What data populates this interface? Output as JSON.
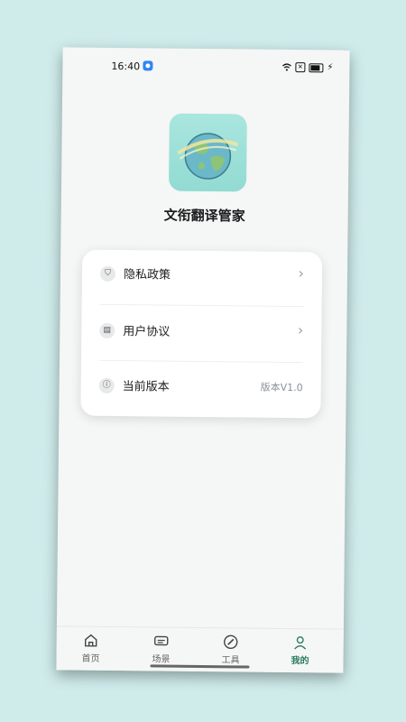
{
  "status_bar": {
    "time": "16:40"
  },
  "app": {
    "title": "文衔翻译管家"
  },
  "menu": {
    "items": [
      {
        "icon": "shield-icon",
        "label": "隐私政策"
      },
      {
        "icon": "document-icon",
        "label": "用户协议"
      },
      {
        "icon": "info-icon",
        "label": "当前版本",
        "value": "版本V1.0"
      }
    ]
  },
  "tabs": [
    {
      "label": "首页",
      "icon": "home-icon"
    },
    {
      "label": "场景",
      "icon": "chat-icon"
    },
    {
      "label": "工具",
      "icon": "tool-icon"
    },
    {
      "label": "我的",
      "icon": "user-icon",
      "active": true
    }
  ],
  "colors": {
    "accent": "#2a7c60",
    "logo_bg": "#9fe0d8",
    "page_bg": "#cfeceb"
  }
}
